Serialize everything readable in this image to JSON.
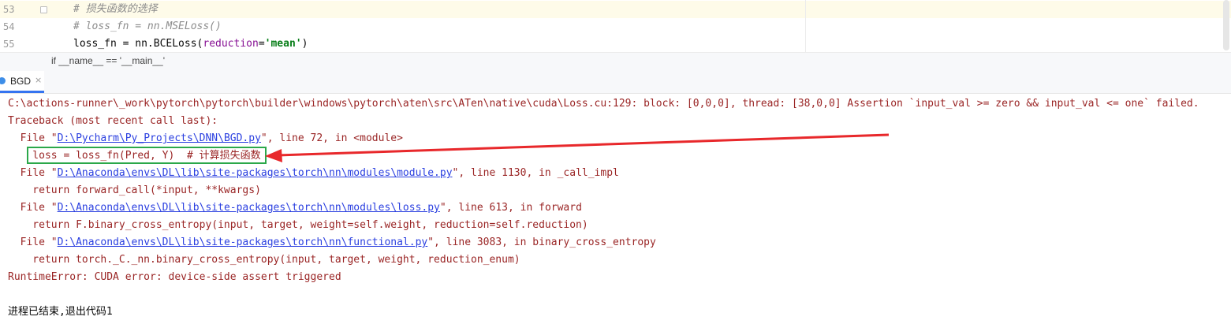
{
  "editor": {
    "lines": [
      {
        "num": "53",
        "text": "# 损失函数的选择"
      },
      {
        "num": "54",
        "text": "# loss_fn = nn.MSELoss()"
      },
      {
        "num": "55",
        "prefix": "loss_fn = nn.BCELoss(",
        "kw": "reduction",
        "eq": "=",
        "str": "'mean'",
        "suffix": ")"
      }
    ],
    "breadcrumb": "if __name__ == '__main__'"
  },
  "run_tab": {
    "label": "BGD",
    "close": "×"
  },
  "console": {
    "assert_line": "C:\\actions-runner\\_work\\pytorch\\pytorch\\builder\\windows\\pytorch\\aten\\src\\ATen\\native\\cuda\\Loss.cu:129: block: [0,0,0], thread: [38,0,0] Assertion `input_val >= zero && input_val <= one` failed.",
    "traceback": "Traceback (most recent call last):",
    "frames": [
      {
        "pre": "  File \"",
        "path": "D:\\Pycharm\\Py_Projects\\DNN\\BGD.py",
        "post": "\", line 72, in <module>",
        "code": "    loss = loss_fn(Pred, Y)  # 计算损失函数"
      },
      {
        "pre": "  File \"",
        "path": "D:\\Anaconda\\envs\\DL\\lib\\site-packages\\torch\\nn\\modules\\module.py",
        "post": "\", line 1130, in _call_impl",
        "code": "    return forward_call(*input, **kwargs)"
      },
      {
        "pre": "  File \"",
        "path": "D:\\Anaconda\\envs\\DL\\lib\\site-packages\\torch\\nn\\modules\\loss.py",
        "post": "\", line 613, in forward",
        "code": "    return F.binary_cross_entropy(input, target, weight=self.weight, reduction=self.reduction)"
      },
      {
        "pre": "  File \"",
        "path": "D:\\Anaconda\\envs\\DL\\lib\\site-packages\\torch\\nn\\functional.py",
        "post": "\", line 3083, in binary_cross_entropy",
        "code": "    return torch._C._nn.binary_cross_entropy(input, target, weight, reduction_enum)"
      }
    ],
    "runtime_error": "RuntimeError: CUDA error: device-side assert triggered",
    "exit_message": "进程已结束,退出代码1"
  },
  "colors": {
    "highlight_box": "#2ba84a",
    "arrow": "#e8282b",
    "link": "#2a3fe0",
    "error": "#9a2525"
  }
}
